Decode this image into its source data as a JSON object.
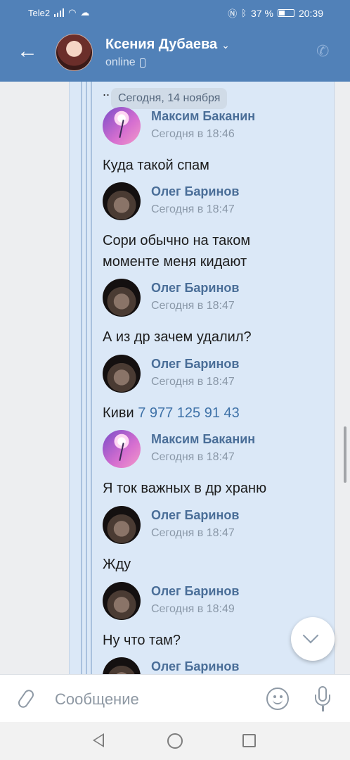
{
  "status_bar": {
    "carrier": "Tele2",
    "battery": "37 %",
    "time": "20:39"
  },
  "header": {
    "contact_name": "Ксения Дубаева",
    "status": "online"
  },
  "chat": {
    "ellipsis": "..",
    "date_divider": "Сегодня, 14 ноября",
    "messages": [
      {
        "author": "Максим Баканин",
        "time": "Сегодня в 18:46",
        "text_lines": [
          "Куда такой спам"
        ],
        "avatar": "flower-avatar"
      },
      {
        "author": "Олег Баринов",
        "time": "Сегодня в 18:47",
        "text_lines": [
          "Сори обычно на таком",
          "моменте меня кидают"
        ],
        "avatar": "dark-avatar"
      },
      {
        "author": "Олег Баринов",
        "time": "Сегодня в 18:47",
        "text_lines": [
          "А из др зачем удалил?"
        ],
        "avatar": "dark-avatar"
      },
      {
        "author": "Олег Баринов",
        "time": "Сегодня в 18:47",
        "text_prefix": "Киви ",
        "text_link": "7 977 125 91 43",
        "avatar": "dark-avatar"
      },
      {
        "author": "Максим Баканин",
        "time": "Сегодня в 18:47",
        "text_lines": [
          "Я ток важных в др храню"
        ],
        "avatar": "flower-avatar"
      },
      {
        "author": "Олег Баринов",
        "time": "Сегодня в 18:47",
        "text_lines": [
          "Жду"
        ],
        "avatar": "dark-avatar"
      },
      {
        "author": "Олег Баринов",
        "time": "Сегодня в 18:49",
        "text_lines": [
          "Ну что там?"
        ],
        "avatar": "dark-avatar"
      },
      {
        "author": "Олег Баринов",
        "avatar": "dark-avatar"
      }
    ]
  },
  "composer": {
    "placeholder": "Сообщение"
  },
  "colors": {
    "header_bg": "#5181b8",
    "forward_bg": "#dbe8f7",
    "author_name": "#4a6e98",
    "link": "#3f72a8"
  }
}
